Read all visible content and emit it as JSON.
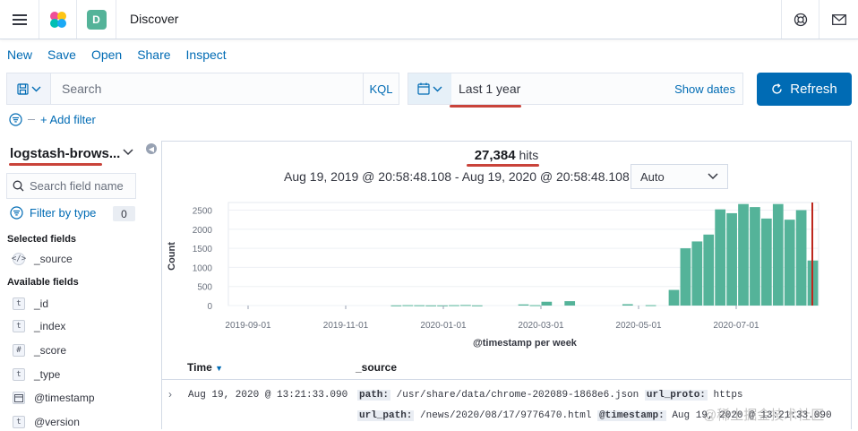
{
  "header": {
    "space_initial": "D",
    "app_title": "Discover"
  },
  "menu": {
    "new": "New",
    "save": "Save",
    "open": "Open",
    "share": "Share",
    "inspect": "Inspect"
  },
  "query": {
    "placeholder": "Search",
    "language": "KQL"
  },
  "date": {
    "range": "Last 1 year",
    "show_dates": "Show dates"
  },
  "refresh_label": "Refresh",
  "filter": {
    "add": "+ Add filter"
  },
  "sidebar": {
    "index_pattern": "logstash-brows...",
    "search_placeholder": "Search field name",
    "filter_type_label": "Filter by type",
    "filter_type_count": "0",
    "selected_title": "Selected fields",
    "selected": [
      {
        "icon": "</>",
        "name": "_source"
      }
    ],
    "available_title": "Available fields",
    "available": [
      {
        "icon": "t",
        "name": "_id"
      },
      {
        "icon": "t",
        "name": "_index"
      },
      {
        "icon": "#",
        "name": "_score"
      },
      {
        "icon": "t",
        "name": "_type"
      },
      {
        "icon": "cal",
        "name": "@timestamp"
      },
      {
        "icon": "t",
        "name": "@version"
      }
    ]
  },
  "results": {
    "hits_count": "27,384",
    "hits_label": "hits",
    "time_range": "Aug 19, 2019 @ 20:58:48.108 - Aug 19, 2020 @ 20:58:48.108 —",
    "interval": "Auto"
  },
  "chart_data": {
    "type": "bar",
    "ylabel": "Count",
    "xlabel": "@timestamp per week",
    "ylim": [
      0,
      2700
    ],
    "yticks": [
      0,
      500,
      1000,
      1500,
      2000,
      2500
    ],
    "xticks": [
      "2019-09-01",
      "2019-11-01",
      "2020-01-01",
      "2020-03-01",
      "2020-05-01",
      "2020-07-01"
    ],
    "bar_color": "#54b399",
    "values": [
      0,
      0,
      0,
      0,
      0,
      0,
      0,
      0,
      0,
      0,
      0,
      0,
      0,
      0,
      5,
      10,
      8,
      5,
      5,
      10,
      15,
      5,
      0,
      0,
      0,
      30,
      10,
      100,
      0,
      115,
      0,
      0,
      0,
      0,
      35,
      0,
      10,
      0,
      410,
      1500,
      1680,
      1860,
      2520,
      2420,
      2660,
      2580,
      2280,
      2660,
      2250,
      2500,
      1180
    ]
  },
  "table": {
    "col_time": "Time",
    "col_source": "_source",
    "row": {
      "time": "Aug 19, 2020 @ 13:21:33.090",
      "path_key": "path:",
      "path_val": "/usr/share/data/chrome-202089-1868e6.json",
      "proto_key": "url_proto:",
      "proto_val": "https",
      "urlpath_key": "url_path:",
      "urlpath_val": "/news/2020/08/17/9776470.html",
      "ts_key": "@timestamp:",
      "ts_val": "Aug 19, 2020 @ 13:21:33.090"
    }
  },
  "watermark": "@稀土掘金技术社区",
  "colors": {
    "accent": "#006bb4",
    "bar": "#54b399",
    "annotation": "#c9433a"
  }
}
